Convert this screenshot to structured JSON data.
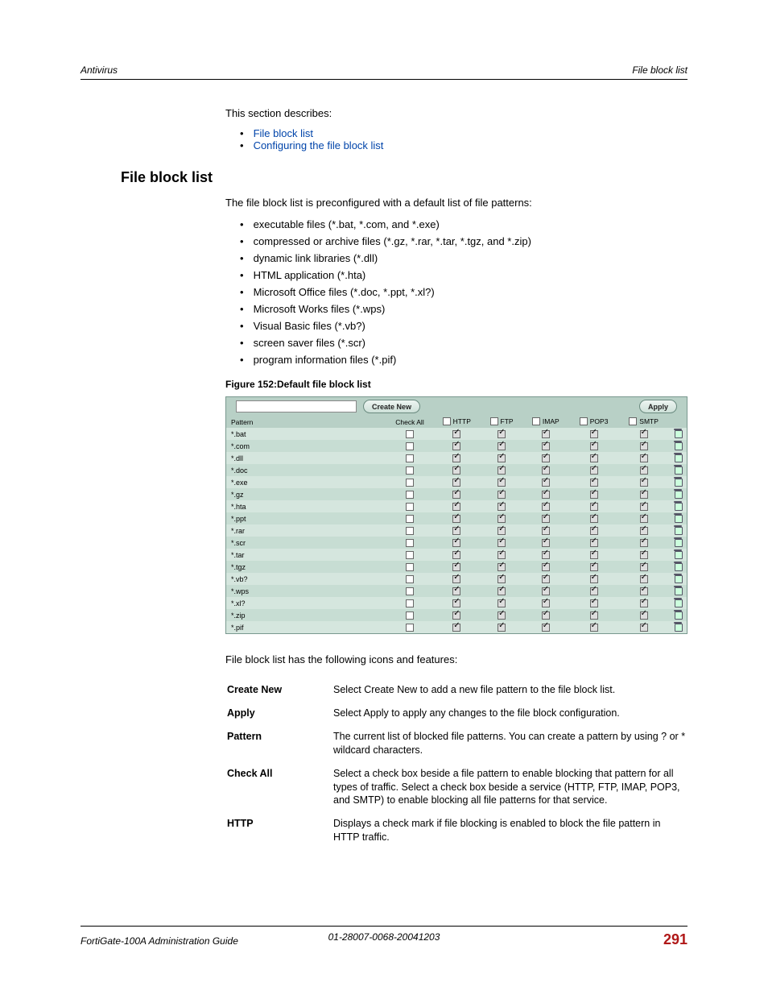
{
  "header": {
    "left": "Antivirus",
    "right": "File block list"
  },
  "intro": "This section describes:",
  "links": [
    "File block list",
    "Configuring the file block list"
  ],
  "section_title": "File block list",
  "para1": "The file block list is preconfigured with a default list of file patterns:",
  "bullets": [
    "executable files (*.bat, *.com, and *.exe)",
    "compressed or archive files (*.gz, *.rar, *.tar, *.tgz, and *.zip)",
    "dynamic link libraries (*.dll)",
    "HTML application (*.hta)",
    "Microsoft Office files (*.doc, *.ppt, *.xl?)",
    "Microsoft Works files (*.wps)",
    "Visual Basic files (*.vb?)",
    "screen saver files (*.scr)",
    "program information files (*.pif)"
  ],
  "figure_caption": "Figure 152:Default file block list",
  "ui": {
    "create_new": "Create New",
    "apply": "Apply",
    "columns": [
      "Pattern",
      "Check All",
      "HTTP",
      "FTP",
      "IMAP",
      "POP3",
      "SMTP",
      ""
    ],
    "rows": [
      "*.bat",
      "*.com",
      "*.dll",
      "*.doc",
      "*.exe",
      "*.gz",
      "*.hta",
      "*.ppt",
      "*.rar",
      "*.scr",
      "*.tar",
      "*.tgz",
      "*.vb?",
      "*.wps",
      "*.xl?",
      "*.zip",
      "*.pif"
    ]
  },
  "features_intro": "File block list has the following icons and features:",
  "features": [
    {
      "k": "Create New",
      "v": "Select Create New to add a new file pattern to the file block list."
    },
    {
      "k": "Apply",
      "v": "Select Apply to apply any changes to the file block configuration."
    },
    {
      "k": "Pattern",
      "v": "The current list of blocked file patterns. You can create a pattern by using ? or * wildcard characters."
    },
    {
      "k": "Check All",
      "v": "Select a check box beside a file pattern to enable blocking that pattern for all types of traffic. Select a check box beside a service (HTTP, FTP, IMAP, POP3, and SMTP) to enable blocking all file patterns for that service."
    },
    {
      "k": "HTTP",
      "v": "Displays a check mark if file blocking is enabled to block the file pattern in HTTP traffic."
    }
  ],
  "footer": {
    "left": "FortiGate-100A Administration Guide",
    "mid": "01-28007-0068-20041203",
    "right": "291"
  }
}
